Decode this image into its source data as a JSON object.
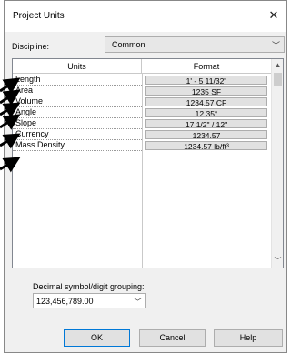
{
  "window": {
    "title": "Project Units",
    "close_symbol": "✕"
  },
  "discipline": {
    "label": "Discipline:",
    "value": "Common"
  },
  "grid": {
    "headers": {
      "units": "Units",
      "format": "Format"
    },
    "rows": [
      {
        "unit": "Length",
        "format": "1' - 5 11/32\""
      },
      {
        "unit": "Area",
        "format": "1235 SF"
      },
      {
        "unit": "Volume",
        "format": "1234.57 CF"
      },
      {
        "unit": "Angle",
        "format": "12.35°"
      },
      {
        "unit": "Slope",
        "format": "17 1/2\" / 12\""
      },
      {
        "unit": "Currency",
        "format": "1234.57"
      },
      {
        "unit": "Mass Density",
        "format": "1234.57 lb/ft³"
      }
    ]
  },
  "decimal": {
    "label": "Decimal symbol/digit grouping:",
    "value": "123,456,789.00"
  },
  "buttons": {
    "ok": "OK",
    "cancel": "Cancel",
    "help": "Help"
  },
  "colors": {
    "accent": "#0078d7",
    "dialog_bg": "#f0f0f0",
    "annotation_arrow": "#000000"
  },
  "icons": [
    "close-icon",
    "chevron-down-icon",
    "scroll-up-icon",
    "scroll-down-icon",
    "annotation-arrow-icon"
  ]
}
